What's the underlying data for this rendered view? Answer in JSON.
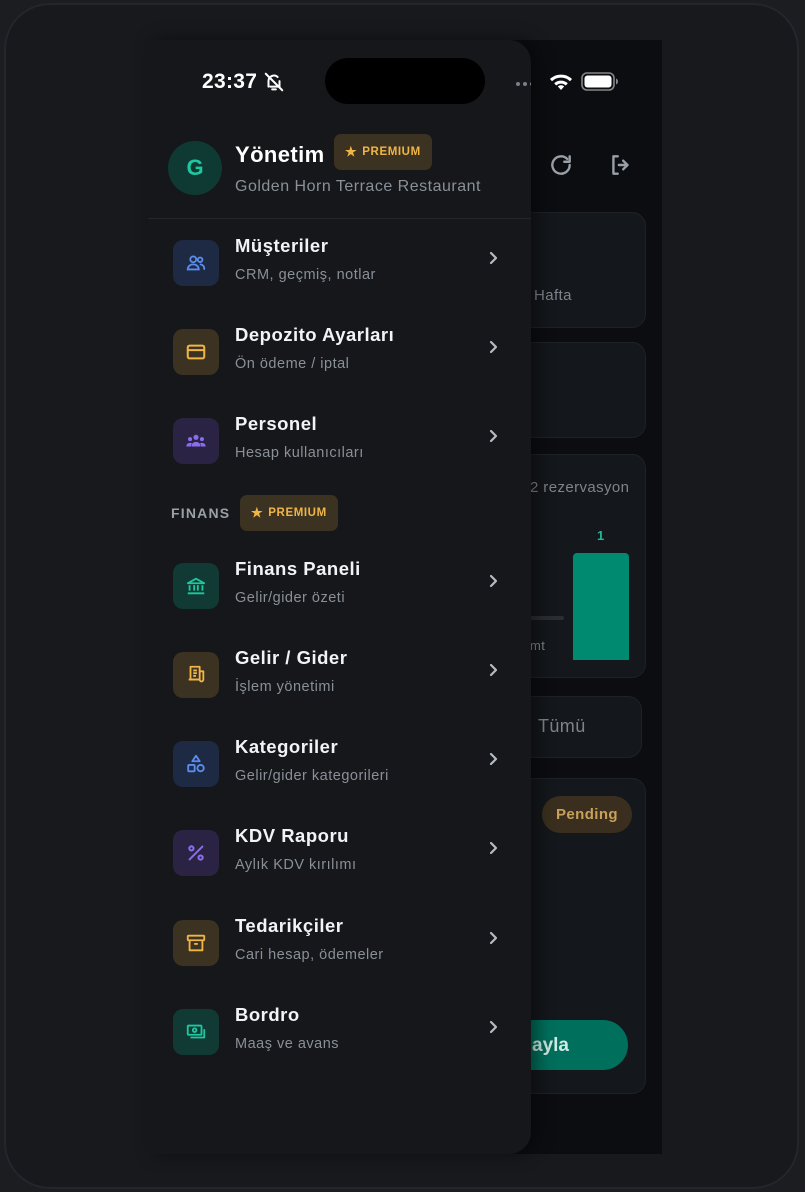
{
  "status_bar": {
    "time": "23:37"
  },
  "background": {
    "hafta_label": "Hafta",
    "reservation_label": "2 rezervasyon",
    "bar_value": "1",
    "axis_label": "mt",
    "filter_label": "Tümü",
    "status_badge": "Pending",
    "action_button": "ayla"
  },
  "drawer": {
    "header": {
      "avatar_letter": "G",
      "title": "Yönetim",
      "premium_badge": "PREMIUM",
      "subtitle": "Golden Horn Terrace Restaurant"
    },
    "items": [
      {
        "title": "Müşteriler",
        "subtitle": "CRM, geçmiş, notlar",
        "icon": "users-icon",
        "color": "#5b8def"
      },
      {
        "title": "Depozito Ayarları",
        "subtitle": "Ön ödeme / iptal",
        "icon": "credit-card-icon",
        "color": "#f0b545"
      },
      {
        "title": "Personel",
        "subtitle": "Hesap kullanıcıları",
        "icon": "team-icon",
        "color": "#8b6cf0"
      }
    ],
    "finance_section": {
      "label": "FINANS",
      "premium_badge": "PREMIUM"
    },
    "finance_items": [
      {
        "title": "Finans Paneli",
        "subtitle": "Gelir/gider özeti",
        "icon": "bank-icon",
        "color": "#1fc7a0"
      },
      {
        "title": "Gelir / Gider",
        "subtitle": "İşlem yönetimi",
        "icon": "receipt-icon",
        "color": "#f0b545"
      },
      {
        "title": "Kategoriler",
        "subtitle": "Gelir/gider kategorileri",
        "icon": "shapes-icon",
        "color": "#5b8def"
      },
      {
        "title": "KDV Raporu",
        "subtitle": "Aylık KDV kırılımı",
        "icon": "percent-icon",
        "color": "#8b6cf0"
      },
      {
        "title": "Tedarikçiler",
        "subtitle": "Cari hesap, ödemeler",
        "icon": "archive-icon",
        "color": "#f0b545"
      },
      {
        "title": "Bordro",
        "subtitle": "Maaş ve avans",
        "icon": "money-icon",
        "color": "#1fc7a0"
      }
    ]
  }
}
